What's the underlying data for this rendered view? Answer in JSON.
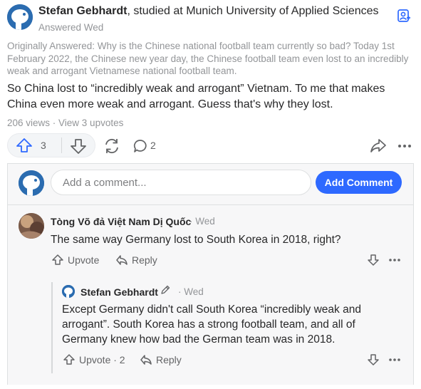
{
  "answer": {
    "author_name": "Stefan Gebhardt",
    "author_credential": ", studied at Munich University of Applied Sciences",
    "answered_label": "Answered Wed",
    "original_question": "Originally Answered: Why is the Chinese national football team currently so bad? Today 1st February 2022, the Chinese new year day, the Chinese football team even lost to an incredibly weak and arrogant Vietnamese national football team.",
    "body": "So China lost to “incredibly weak and arrogant” Vietnam. To me that makes China even more weak and arrogant. Guess that's why they lost.",
    "stats": "206 views · View 3 upvotes",
    "upvote_count": "3",
    "comment_count": "2"
  },
  "comment_box": {
    "placeholder": "Add a comment...",
    "button_label": "Add Comment"
  },
  "comments": [
    {
      "author": "Tòng Võ đả Việt Nam Dị Quốc",
      "date": "· Wed",
      "text": "The same way Germany lost to South Korea in 2018, right?",
      "upvote_label": "Upvote",
      "reply_label": "Reply"
    },
    {
      "author": "Stefan Gebhardt",
      "date": "· Wed",
      "text": "Except Germany didn't call South Korea “incredibly weak and arrogant”. South Korea has a strong football team, and all of Germany knew how bad the German team was in 2018.",
      "upvote_label": "Upvote · 2",
      "reply_label": "Reply"
    }
  ],
  "colors": {
    "accent": "#2e69ff",
    "muted_text": "#939598",
    "panel_bg": "#f7f7f8"
  },
  "icons": {
    "follow": "add-user-icon",
    "upvote": "arrow-up-icon",
    "downvote": "arrow-down-icon",
    "share": "rotate-icon",
    "comment": "speech-bubble-icon",
    "forward": "share-arrow-icon",
    "more": "ellipsis-icon",
    "reply": "reply-arrow-icon",
    "edit": "pen-icon"
  }
}
